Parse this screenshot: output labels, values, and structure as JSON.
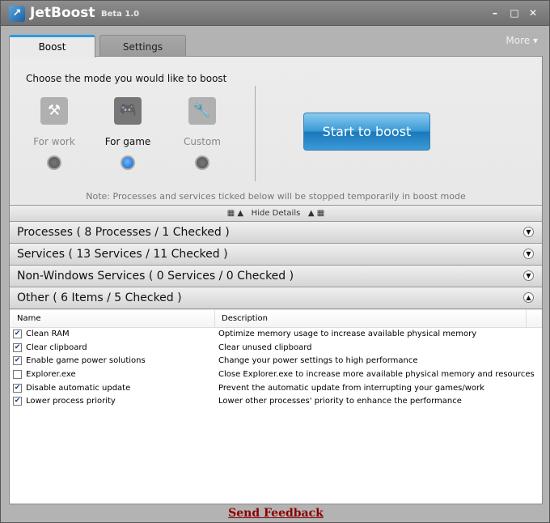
{
  "title": {
    "app": "JetBoost",
    "version": "Beta 1.0"
  },
  "more": "More ▾",
  "tabs": [
    {
      "label": "Boost"
    },
    {
      "label": "Settings"
    }
  ],
  "boost": {
    "prompt": "Choose the mode you would like to boost",
    "modes": [
      {
        "label": "For work",
        "selected": false
      },
      {
        "label": "For game",
        "selected": true
      },
      {
        "label": "Custom",
        "selected": false
      }
    ],
    "start_label": "Start to boost",
    "note": "Note: Processes and services ticked below will be stopped temporarily in boost mode",
    "hide_details": "Hide Details"
  },
  "sections": [
    {
      "label": "Processes ( 8 Processes / 1 Checked )"
    },
    {
      "label": "Services ( 13 Services / 11 Checked )"
    },
    {
      "label": "Non-Windows Services ( 0 Services / 0 Checked )"
    },
    {
      "label": "Other ( 6 Items / 5 Checked )"
    }
  ],
  "table": {
    "columns": [
      "Name",
      "Description"
    ],
    "rows": [
      {
        "name": "Clean RAM",
        "desc": "Optimize memory usage to increase available physical memory",
        "checked": true
      },
      {
        "name": "Clear clipboard",
        "desc": "Clear unused clipboard",
        "checked": true
      },
      {
        "name": "Enable game power solutions",
        "desc": "Change your power settings to high performance",
        "checked": true
      },
      {
        "name": "Explorer.exe",
        "desc": "Close Explorer.exe to increase more available physical memory and resources",
        "checked": false
      },
      {
        "name": "Disable automatic update",
        "desc": "Prevent the automatic update from interrupting your games/work",
        "checked": true
      },
      {
        "name": "Lower process priority",
        "desc": "Lower other processes' priority to enhance the performance",
        "checked": true
      }
    ]
  },
  "feedback": "Send Feedback"
}
